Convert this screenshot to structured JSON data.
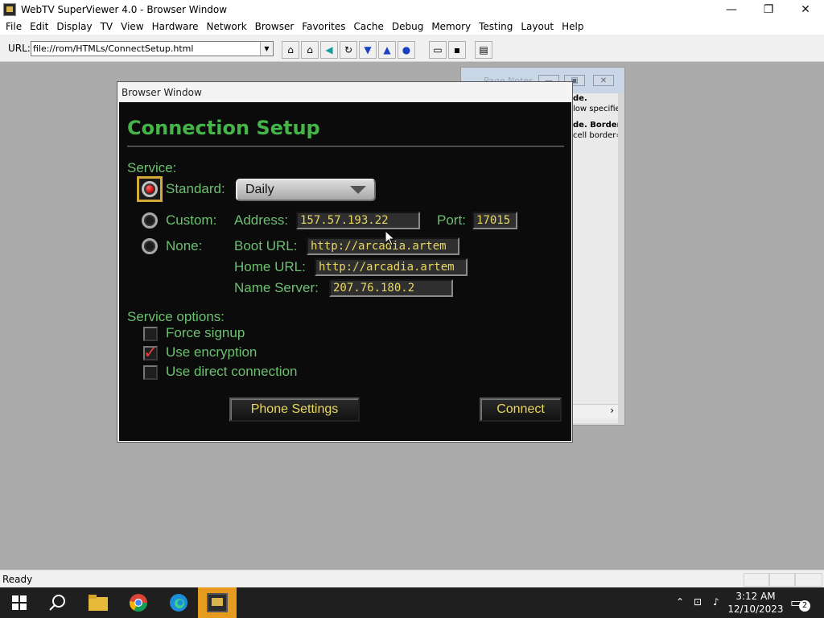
{
  "window": {
    "title": "WebTV SuperViewer 4.0 - Browser Window",
    "minimize": "—",
    "restore": "❐",
    "close": "✕"
  },
  "menu": [
    "File",
    "Edit",
    "Display",
    "TV",
    "View",
    "Hardware",
    "Network",
    "Browser",
    "Favorites",
    "Cache",
    "Debug",
    "Memory",
    "Testing",
    "Layout",
    "Help"
  ],
  "toolbar": {
    "url_label": "URL:",
    "url_value": "file://rom/HTMLs/ConnectSetup.html",
    "buttons": [
      "home-icon",
      "house-icon",
      "back-icon",
      "reload-icon",
      "down-icon",
      "up-icon",
      "stop-icon",
      "open-folder-icon",
      "save-icon",
      "page-icon"
    ]
  },
  "backwindow": {
    "title": "Page Notes",
    "lines": [
      "de.",
      "low specifie",
      "de. Border",
      "cell border="
    ],
    "scroll_arrow": "›"
  },
  "browser": {
    "title": "Browser Window",
    "heading": "Connection Setup",
    "service_label": "Service:",
    "standard_label": "Standard:",
    "standard_value": "Daily",
    "custom_label": "Custom:",
    "address_label": "Address:",
    "address_value": "157.57.193.22",
    "port_label": "Port:",
    "port_value": "17015",
    "none_label": "None:",
    "boot_url_label": "Boot URL:",
    "boot_url_value": "http://arcadia.artem",
    "home_url_label": "Home URL:",
    "home_url_value": "http://arcadia.artem",
    "name_server_label": "Name Server:",
    "name_server_value": "207.76.180.2",
    "options_label": "Service options:",
    "force_signup": "Force signup",
    "use_encryption": "Use encryption",
    "use_direct": "Use direct connection",
    "phone_settings": "Phone Settings",
    "connect": "Connect",
    "selected_service": "Standard",
    "encryption_checked": true
  },
  "status": {
    "text": "Ready"
  },
  "taskbar": {
    "time": "3:12 AM",
    "date": "12/10/2023",
    "notifications": "2"
  },
  "colors": {
    "tv_label": "#6cc070",
    "tv_title": "#45b54a",
    "tv_value": "#e8d760"
  }
}
